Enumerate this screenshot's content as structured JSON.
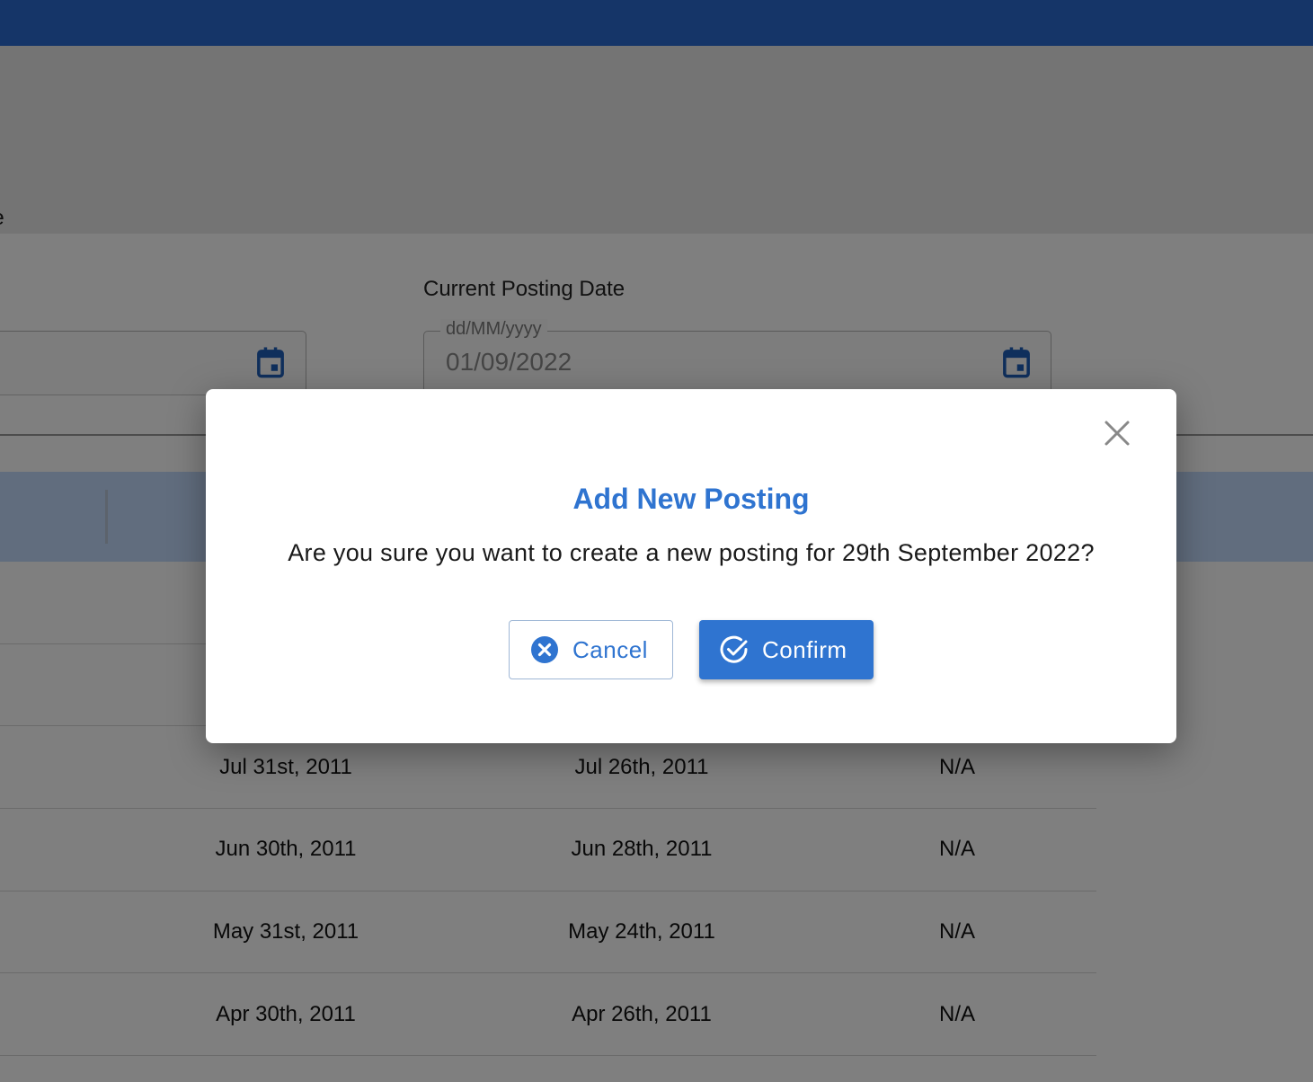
{
  "background": {
    "partial_text": "ere",
    "current_posting": {
      "label": "Current Posting Date",
      "placeholder": "dd/MM/yyyy",
      "value": "01/09/2022"
    },
    "table": {
      "rows": [
        [
          "",
          "",
          ""
        ],
        [
          "",
          "",
          ""
        ],
        [
          "Jul 31st, 2011",
          "Jul 26th, 2011",
          "N/A"
        ],
        [
          "Jun 30th, 2011",
          "Jun 28th, 2011",
          "N/A"
        ],
        [
          "May 31st, 2011",
          "May 24th, 2011",
          "N/A"
        ],
        [
          "Apr 30th, 2011",
          "Apr 26th, 2011",
          "N/A"
        ]
      ]
    }
  },
  "dialog": {
    "title": "Add New Posting",
    "message": "Are you sure you want to create a new posting for 29th September 2022?",
    "cancel_label": "Cancel",
    "confirm_label": "Confirm"
  },
  "colors": {
    "app_bar": "#2a6ad1",
    "accent": "#2f74d0",
    "table_header": "#c3dafc"
  },
  "icons": {
    "close": "close-icon",
    "calendar": "calendar-icon",
    "cancel": "cancel-circle-icon",
    "confirm": "check-circle-icon"
  }
}
